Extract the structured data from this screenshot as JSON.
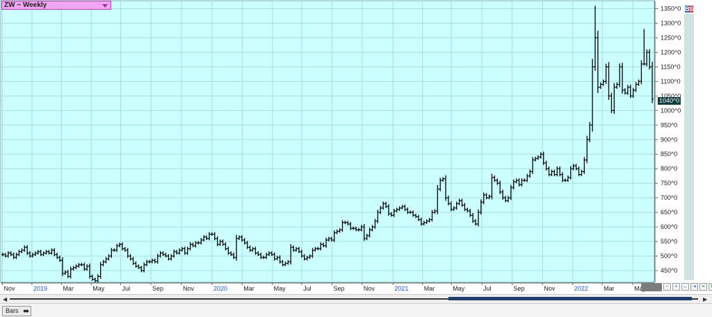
{
  "symbol": "ZW ~ Weekly",
  "buy_label": "B",
  "sell_label": "S",
  "last_price": "1040^0",
  "bottom_tab": "Bars",
  "colors": {
    "plot_bg": "#ccffff",
    "grid": "#a8dcdc",
    "bars": "#000000",
    "axis_bg": "#ffffff",
    "year_label": "#1e50d8"
  },
  "icons": {
    "symbol_dropdown": "triangle-down-icon",
    "scroll_left": "arrow-left-icon",
    "scroll_right": "arrow-right-icon"
  },
  "chart_data": {
    "type": "ohlc",
    "y_tick_labels": [
      "450^0",
      "500^0",
      "550^0",
      "600^0",
      "650^0",
      "700^0",
      "750^0",
      "800^0",
      "850^0",
      "900^0",
      "950^0",
      "1000^0",
      "1050^0",
      "1100^0",
      "1150^0",
      "1200^0",
      "1250^0",
      "1300^0",
      "1350^0"
    ],
    "y_ticks": [
      450,
      500,
      550,
      600,
      650,
      700,
      750,
      800,
      850,
      900,
      950,
      1000,
      1050,
      1100,
      1150,
      1200,
      1250,
      1300,
      1350
    ],
    "ylim": [
      412,
      1375
    ],
    "x_ticks": [
      {
        "label": "Nov",
        "x": 0.3,
        "year": false
      },
      {
        "label": "2019",
        "x": 8.8,
        "year": true
      },
      {
        "label": "Mar",
        "x": 17.3,
        "year": false
      },
      {
        "label": "May",
        "x": 25.9,
        "year": false
      },
      {
        "label": "Jul",
        "x": 34.4,
        "year": false
      },
      {
        "label": "Sep",
        "x": 43.1,
        "year": false
      },
      {
        "label": "Nov",
        "x": 51.9,
        "year": false
      },
      {
        "label": "2020",
        "x": 60.7,
        "year": true
      },
      {
        "label": "Mar",
        "x": 69.4,
        "year": false
      },
      {
        "label": "May",
        "x": 78.1,
        "year": false
      },
      {
        "label": "Jul",
        "x": 86.6,
        "year": false
      },
      {
        "label": "Sep",
        "x": 95.3,
        "year": false
      },
      {
        "label": "Nov",
        "x": 104.0,
        "year": false
      },
      {
        "label": "2021",
        "x": 112.9,
        "year": true
      },
      {
        "label": "Mar",
        "x": 121.4,
        "year": false
      },
      {
        "label": "May",
        "x": 129.7,
        "year": false
      },
      {
        "label": "Jul",
        "x": 138.5,
        "year": false
      },
      {
        "label": "Sep",
        "x": 147.2,
        "year": false
      },
      {
        "label": "Nov",
        "x": 156.0,
        "year": false
      },
      {
        "label": "2022",
        "x": 164.7,
        "year": true
      },
      {
        "label": "Mar",
        "x": 173.2,
        "year": false
      },
      {
        "label": "May",
        "x": 182.0,
        "year": false
      }
    ],
    "x_range": [
      0,
      188
    ],
    "closes": [
      505,
      500,
      510,
      505,
      495,
      505,
      515,
      520,
      530,
      510,
      500,
      505,
      510,
      515,
      505,
      510,
      515,
      510,
      520,
      505,
      495,
      485,
      440,
      445,
      430,
      455,
      460,
      465,
      470,
      470,
      455,
      465,
      430,
      420,
      415,
      430,
      470,
      480,
      490,
      500,
      520,
      520,
      535,
      540,
      525,
      520,
      500,
      490,
      475,
      465,
      460,
      450,
      470,
      480,
      480,
      485,
      480,
      500,
      510,
      505,
      500,
      490,
      500,
      515,
      510,
      520,
      525,
      510,
      525,
      540,
      535,
      545,
      545,
      555,
      565,
      560,
      575,
      575,
      560,
      540,
      550,
      540,
      525,
      510,
      505,
      495,
      560,
      565,
      555,
      545,
      530,
      520,
      525,
      510,
      505,
      495,
      495,
      505,
      510,
      505,
      490,
      495,
      480,
      470,
      475,
      480,
      530,
      520,
      525,
      515,
      500,
      490,
      495,
      500,
      520,
      525,
      525,
      540,
      535,
      555,
      560,
      555,
      580,
      585,
      590,
      615,
      615,
      610,
      595,
      595,
      590,
      590,
      600,
      560,
      570,
      590,
      600,
      620,
      650,
      665,
      680,
      670,
      645,
      640,
      655,
      660,
      665,
      670,
      660,
      650,
      650,
      640,
      635,
      625,
      610,
      615,
      620,
      625,
      650,
      655,
      730,
      760,
      765,
      700,
      680,
      660,
      665,
      680,
      690,
      675,
      660,
      655,
      640,
      620,
      610,
      650,
      685,
      710,
      700,
      705,
      770,
      760,
      750,
      720,
      700,
      690,
      700,
      735,
      755,
      760,
      745,
      760,
      760,
      775,
      790,
      830,
      835,
      840,
      850,
      820,
      800,
      780,
      790,
      780,
      800,
      780,
      760,
      760,
      770,
      800,
      810,
      800,
      780,
      790,
      830,
      900,
      950,
      1150,
      1250,
      1080,
      1090,
      1100,
      1150,
      1050,
      1000,
      1080,
      1090,
      1150,
      1070,
      1060,
      1080,
      1050,
      1070,
      1090,
      1100,
      1160,
      1160,
      1200,
      1150,
      1040
    ],
    "highs_overrides": {
      "218": 1360,
      "236": 1280
    },
    "title": "",
    "xlabel": "",
    "ylabel": "",
    "grid": true,
    "legend": "none"
  }
}
